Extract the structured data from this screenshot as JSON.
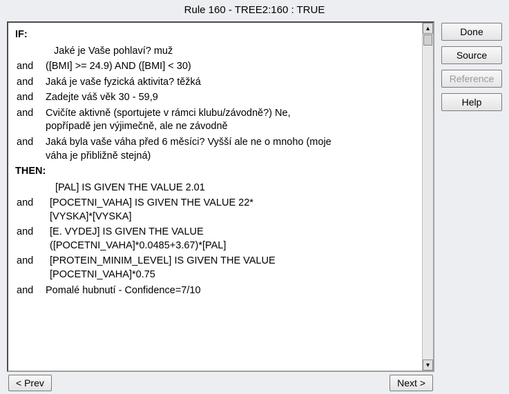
{
  "title": "Rule 160 - TREE2:160 : TRUE",
  "if_label": "IF:",
  "then_label": "THEN:",
  "if_conditions": [
    {
      "op": "",
      "text": "Jaké je Vaše pohlaví? muž"
    },
    {
      "op": "and",
      "text": "([BMI] >= 24.9) AND ([BMI] < 30)"
    },
    {
      "op": "and",
      "text": "Jaká je vaše fyzická aktivita? těžká"
    },
    {
      "op": "and",
      "text": "Zadejte váš věk 30 - 59,9"
    },
    {
      "op": "and",
      "text": "Cvičíte aktivně (sportujete v rámci klubu/závodně?) Ne, popřípadě jen výjimečně, ale ne závodně"
    },
    {
      "op": "and",
      "text": "Jaká byla vaše váha před 6 měsíci? Vyšší ale ne o mnoho (moje váha je přibližně stejná)"
    }
  ],
  "then_actions": [
    {
      "op": "",
      "text": "[PAL] IS GIVEN THE VALUE 2.01"
    },
    {
      "op": "and",
      "text": "[POCETNI_VAHA] IS GIVEN THE VALUE 22*[VYSKA]*[VYSKA]"
    },
    {
      "op": "and",
      "text": "[E. VYDEJ] IS GIVEN THE VALUE ([POCETNI_VAHA]*0.0485+3.67)*[PAL]"
    },
    {
      "op": "and",
      "text": "[PROTEIN_MINIM_LEVEL] IS GIVEN THE VALUE [POCETNI_VAHA]*0.75"
    },
    {
      "op": "and",
      "text": "Pomalé hubnutí - Confidence=7/10"
    }
  ],
  "buttons": {
    "done": "Done",
    "source": "Source",
    "reference": "Reference",
    "help": "Help",
    "prev": "< Prev",
    "next": "Next >"
  }
}
